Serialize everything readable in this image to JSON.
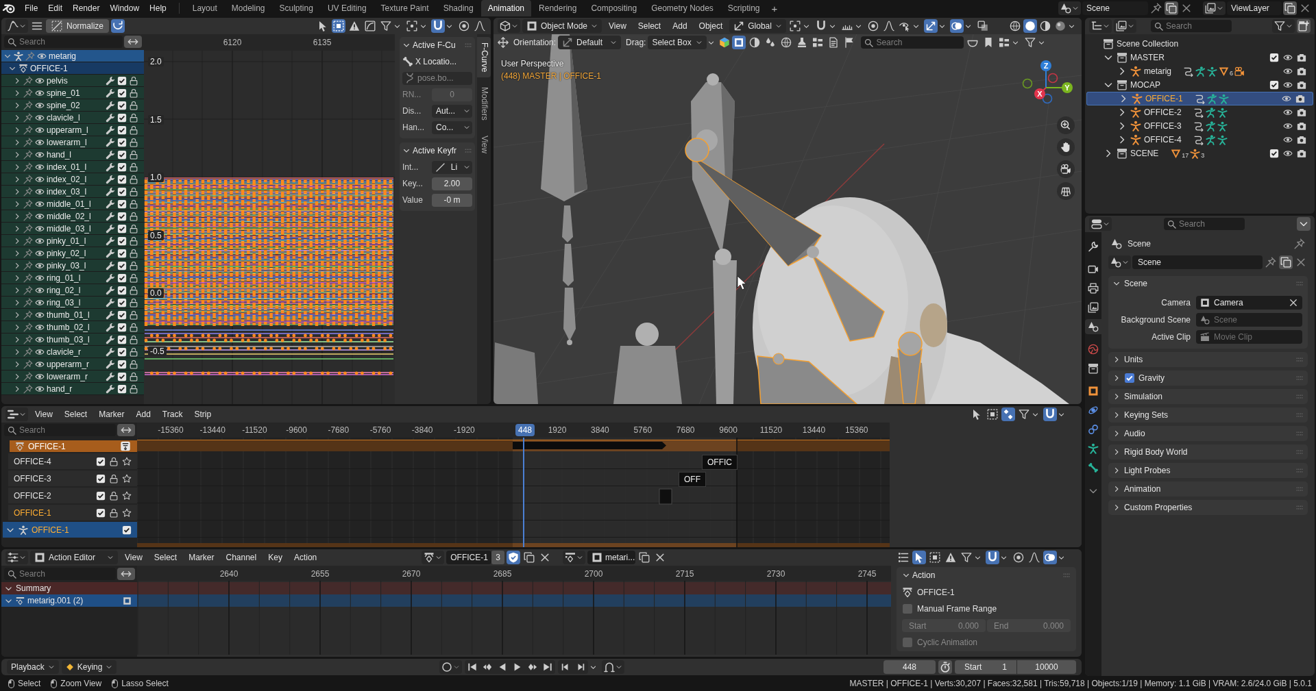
{
  "topbar": {
    "menus": [
      "File",
      "Edit",
      "Render",
      "Window",
      "Help"
    ],
    "workspaces": [
      {
        "label": "Layout",
        "selected": false
      },
      {
        "label": "Modeling",
        "selected": false
      },
      {
        "label": "Sculpting",
        "selected": false
      },
      {
        "label": "UV Editing",
        "selected": false
      },
      {
        "label": "Texture Paint",
        "selected": false
      },
      {
        "label": "Shading",
        "selected": false
      },
      {
        "label": "Animation",
        "selected": true
      },
      {
        "label": "Rendering",
        "selected": false
      },
      {
        "label": "Compositing",
        "selected": false
      },
      {
        "label": "Geometry Nodes",
        "selected": false
      },
      {
        "label": "Scripting",
        "selected": false
      }
    ],
    "add_workspace": "+",
    "scene": "Scene",
    "view_layer": "ViewLayer"
  },
  "graph_editor": {
    "normalize": "Normalize",
    "auto_normalize": true,
    "tools": [
      {
        "kind": "cursor",
        "on": false
      },
      {
        "kind": "box-select",
        "on": true
      },
      {
        "kind": "warning",
        "on": false
      },
      {
        "kind": "curve-box",
        "on": false
      },
      {
        "kind": "filter",
        "on": false
      },
      {
        "kind": "pivot",
        "on": false
      },
      {
        "kind": "magnet",
        "on": true
      },
      {
        "kind": "circle-dot",
        "on": false
      },
      {
        "kind": "falloff",
        "on": false
      }
    ],
    "search_placeholder": "Search",
    "channels": [
      {
        "name": "metarig",
        "kind": "object",
        "expanded": true,
        "children": [
          {
            "name": "OFFICE-1",
            "kind": "action",
            "expanded": true,
            "children": [
              {
                "name": "pelvis",
                "kind": "group",
                "expanded": false,
                "checked": true
              },
              {
                "name": "spine_01",
                "kind": "group",
                "expanded": false,
                "checked": true
              },
              {
                "name": "spine_02",
                "kind": "group",
                "expanded": false,
                "checked": true
              },
              {
                "name": "clavicle_l",
                "kind": "group",
                "expanded": false,
                "checked": true
              },
              {
                "name": "upperarm_l",
                "kind": "group",
                "expanded": false,
                "checked": true
              },
              {
                "name": "lowerarm_l",
                "kind": "group",
                "expanded": false,
                "checked": true
              },
              {
                "name": "hand_l",
                "kind": "group",
                "expanded": false,
                "checked": true
              },
              {
                "name": "index_01_l",
                "kind": "group",
                "expanded": false,
                "checked": true
              },
              {
                "name": "index_02_l",
                "kind": "group",
                "expanded": false,
                "checked": true
              },
              {
                "name": "index_03_l",
                "kind": "group",
                "expanded": false,
                "checked": true
              },
              {
                "name": "middle_01_l",
                "kind": "group",
                "expanded": false,
                "checked": true
              },
              {
                "name": "middle_02_l",
                "kind": "group",
                "expanded": false,
                "checked": true
              },
              {
                "name": "middle_03_l",
                "kind": "group",
                "expanded": false,
                "checked": true
              },
              {
                "name": "pinky_01_l",
                "kind": "group",
                "expanded": false,
                "checked": true
              },
              {
                "name": "pinky_02_l",
                "kind": "group",
                "expanded": false,
                "checked": true
              },
              {
                "name": "pinky_03_l",
                "kind": "group",
                "expanded": false,
                "checked": true
              },
              {
                "name": "ring_01_l",
                "kind": "group",
                "expanded": false,
                "checked": true
              },
              {
                "name": "ring_02_l",
                "kind": "group",
                "expanded": false,
                "checked": true
              },
              {
                "name": "ring_03_l",
                "kind": "group",
                "expanded": false,
                "checked": true
              },
              {
                "name": "thumb_01_l",
                "kind": "group",
                "expanded": false,
                "checked": true
              },
              {
                "name": "thumb_02_l",
                "kind": "group",
                "expanded": false,
                "checked": true
              },
              {
                "name": "thumb_03_l",
                "kind": "group",
                "expanded": false,
                "checked": true
              },
              {
                "name": "clavicle_r",
                "kind": "group",
                "expanded": false,
                "checked": true
              },
              {
                "name": "upperarm_r",
                "kind": "group",
                "expanded": false,
                "checked": true
              },
              {
                "name": "lowerarm_r",
                "kind": "group",
                "expanded": false,
                "checked": true
              },
              {
                "name": "hand_r",
                "kind": "group",
                "expanded": false,
                "checked": true
              }
            ]
          }
        ]
      }
    ],
    "ruler": [
      "6120",
      "6135"
    ],
    "y_ticks": [
      "2.0",
      "1.5",
      "1.0",
      "0.5",
      "0.0",
      "-0.5"
    ],
    "sidebar": {
      "fcurve_panel": {
        "title": "Active F-Cu",
        "expanded": true,
        "channel": "X Locatio...",
        "path": "pose.bo...",
        "rna_label": "RN...",
        "rna_index": "0",
        "display_label": "Dis...",
        "display": "Aut...",
        "handle_label": "Han...",
        "handle": "Co..."
      },
      "keyframe_panel": {
        "title": "Active Keyfr",
        "expanded": true,
        "interp_label": "Int...",
        "interp": "Li",
        "key_label": "Key...",
        "key": "2.00",
        "value_label": "Value",
        "value": "-0 m"
      }
    },
    "tabs": [
      {
        "label": "F-Curve",
        "selected": true
      },
      {
        "label": "Modifiers",
        "selected": false
      },
      {
        "label": "View",
        "selected": false
      }
    ]
  },
  "viewport": {
    "mode": "Object Mode",
    "menus": [
      "View",
      "Select",
      "Add",
      "Object"
    ],
    "transform": "Global",
    "tools": [
      {
        "kind": "pivot",
        "on": false
      },
      {
        "kind": "magnet",
        "on": false
      },
      {
        "kind": "ruler",
        "on": false
      },
      {
        "kind": "circle-dot",
        "on": false
      },
      {
        "kind": "falloff",
        "on": false
      },
      {
        "kind": "eye-cursor",
        "on": false
      },
      {
        "kind": "axis-arrows",
        "on": true
      },
      {
        "kind": "overlays",
        "on": true
      },
      {
        "kind": "xray",
        "on": false
      }
    ],
    "shading": [
      {
        "kind": "wire",
        "selected": false
      },
      {
        "kind": "solid",
        "selected": true
      },
      {
        "kind": "material",
        "selected": false
      },
      {
        "kind": "rendered",
        "selected": false
      }
    ],
    "orientation_label": "Orientation:",
    "orientation": "Default",
    "drag_label": "Drag:",
    "drag": "Select Box",
    "select_modes": [
      {
        "kind": "square",
        "on": true
      },
      {
        "kind": "material",
        "on": false
      },
      {
        "kind": "drops",
        "on": false
      },
      {
        "kind": "globe",
        "on": false
      },
      {
        "kind": "stamp",
        "on": false
      },
      {
        "kind": "layout",
        "on": false
      },
      {
        "kind": "document",
        "on": false
      },
      {
        "kind": "flag",
        "on": false
      }
    ],
    "search_placeholder": "Search",
    "view_name": "User Perspective",
    "info": "(448) MASTER | OFFICE-1",
    "gizmo": {
      "z": "Z",
      "y": "Y",
      "x": "X"
    }
  },
  "outliner": {
    "search_placeholder": "Search",
    "tree": [
      {
        "name": "Scene Collection",
        "kind": "scene-collection",
        "children": [
          {
            "name": "MASTER",
            "kind": "collection",
            "expanded": true,
            "checked": true,
            "children": [
              {
                "name": "metarig",
                "kind": "armature",
                "expanded": false,
                "selected": false,
                "extras": [
                  {
                    "kind": "pose"
                  },
                  {
                    "kind": "pose-figure"
                  },
                  {
                    "kind": "armature-data"
                  },
                  {
                    "kind": "mesh",
                    "count": "6"
                  },
                  {
                    "kind": "camera-object"
                  }
                ]
              }
            ]
          },
          {
            "name": "MOCAP",
            "kind": "collection",
            "expanded": true,
            "checked": true,
            "children": [
              {
                "name": "OFFICE-1",
                "kind": "armature",
                "expanded": false,
                "selected": true,
                "extras": [
                  {
                    "kind": "pose"
                  },
                  {
                    "kind": "pose-figure"
                  },
                  {
                    "kind": "armature-data"
                  }
                ]
              },
              {
                "name": "OFFICE-2",
                "kind": "armature",
                "expanded": false,
                "selected": false,
                "extras": [
                  {
                    "kind": "pose"
                  },
                  {
                    "kind": "pose-figure"
                  },
                  {
                    "kind": "armature-data"
                  }
                ]
              },
              {
                "name": "OFFICE-3",
                "kind": "armature",
                "expanded": false,
                "selected": false,
                "extras": [
                  {
                    "kind": "pose"
                  },
                  {
                    "kind": "pose-figure"
                  },
                  {
                    "kind": "armature-data"
                  }
                ]
              },
              {
                "name": "OFFICE-4",
                "kind": "armature",
                "expanded": false,
                "selected": false,
                "extras": [
                  {
                    "kind": "pose"
                  },
                  {
                    "kind": "pose-figure"
                  },
                  {
                    "kind": "armature-data"
                  }
                ]
              }
            ]
          },
          {
            "name": "SCENE",
            "kind": "collection",
            "expanded": false,
            "checked": true,
            "extras": [
              {
                "kind": "mesh",
                "count": "17"
              },
              {
                "kind": "armature-object",
                "count": "3"
              }
            ]
          }
        ]
      }
    ]
  },
  "properties": {
    "search_placeholder": "Search",
    "tabs": [
      {
        "kind": "tool",
        "selected": false
      },
      {
        "kind": "render",
        "selected": false
      },
      {
        "kind": "output",
        "selected": false
      },
      {
        "kind": "view-layer",
        "selected": false
      },
      {
        "kind": "scene",
        "selected": true
      },
      {
        "kind": "world",
        "selected": false
      },
      {
        "kind": "collection",
        "selected": false
      },
      {
        "kind": "object",
        "selected": false
      },
      {
        "kind": "physics",
        "selected": false
      },
      {
        "kind": "constraints",
        "selected": false
      },
      {
        "kind": "armature",
        "selected": false
      },
      {
        "kind": "bone",
        "selected": false
      }
    ],
    "context": "Scene",
    "datablock": "Scene",
    "panels": [
      {
        "title": "Scene",
        "expanded": true,
        "rows": [
          {
            "label": "Camera",
            "kind": "object",
            "value": "Camera"
          },
          {
            "label": "Background Scene",
            "kind": "scene",
            "placeholder": "Scene"
          },
          {
            "label": "Active Clip",
            "kind": "clip",
            "placeholder": "Movie Clip"
          }
        ]
      },
      {
        "title": "Units",
        "expanded": false
      },
      {
        "title": "Gravity",
        "expanded": false,
        "toggle": {
          "checked": true
        }
      },
      {
        "title": "Simulation",
        "expanded": false
      },
      {
        "title": "Keying Sets",
        "expanded": false
      },
      {
        "title": "Audio",
        "expanded": false
      },
      {
        "title": "Rigid Body World",
        "expanded": false
      },
      {
        "title": "Light Probes",
        "expanded": false
      },
      {
        "title": "Animation",
        "expanded": false
      },
      {
        "title": "Custom Properties",
        "expanded": false
      }
    ]
  },
  "nla": {
    "menus": [
      "View",
      "Select",
      "Marker",
      "Add",
      "Track",
      "Strip"
    ],
    "tools": [
      {
        "kind": "cursor",
        "on": false
      },
      {
        "kind": "box-select",
        "on": false
      },
      {
        "kind": "diamonds",
        "on": true
      },
      {
        "kind": "filter",
        "on": false
      },
      {
        "kind": "magnet",
        "on": true
      }
    ],
    "search_placeholder": "Search",
    "ruler": [
      "-15360",
      "-13440",
      "-11520",
      "-9600",
      "-7680",
      "-5760",
      "-3840",
      "-1920",
      "1920",
      "3840",
      "5760",
      "7680",
      "9600",
      "11520",
      "13440",
      "15360"
    ],
    "playhead": "448",
    "tracks": [
      {
        "name": "OFFICE-1",
        "kind": "action-line"
      },
      {
        "name": "OFFICE-4",
        "kind": "track",
        "checked": true,
        "active": false
      },
      {
        "name": "OFFICE-3",
        "kind": "track",
        "checked": true,
        "active": false
      },
      {
        "name": "OFFICE-2",
        "kind": "track",
        "checked": true,
        "active": false
      },
      {
        "name": "OFFICE-1",
        "kind": "track",
        "checked": true,
        "active": true
      },
      {
        "name": "OFFICE-1",
        "kind": "object",
        "checked": true,
        "expanded": true
      }
    ],
    "strips": [
      {
        "label": "OFFIC"
      },
      {
        "label": "OFF"
      }
    ]
  },
  "action_editor": {
    "mode": "Action Editor",
    "menus": [
      "View",
      "Select",
      "Marker",
      "Channel",
      "Key",
      "Action"
    ],
    "action": "OFFICE-1",
    "users": "3",
    "fake_user": true,
    "slot": "metari...",
    "tools": [
      {
        "kind": "channel-list",
        "on": false
      },
      {
        "kind": "cursor",
        "on": true
      },
      {
        "kind": "box-select",
        "on": false
      },
      {
        "kind": "warning",
        "on": false
      },
      {
        "kind": "filter",
        "on": false
      },
      {
        "kind": "magnet",
        "on": true
      },
      {
        "kind": "circle-dot",
        "on": false
      },
      {
        "kind": "falloff",
        "on": false
      },
      {
        "kind": "overlays",
        "on": true
      }
    ],
    "search_placeholder": "Search",
    "ruler": [
      "2640",
      "2655",
      "2670",
      "2685",
      "2700",
      "2715",
      "2730",
      "2745"
    ],
    "channels": [
      {
        "name": "Summary",
        "kind": "summary",
        "expanded": true
      },
      {
        "name": "metarig.001 (2)",
        "kind": "slot",
        "expanded": true
      }
    ],
    "sidebar": {
      "title": "Action",
      "expanded": true,
      "action": "OFFICE-1",
      "manual_range": {
        "label": "Manual Frame Range",
        "checked": false
      },
      "frame_range": {
        "disabled": true,
        "start_label": "Start",
        "start": "0.000",
        "end_label": "End",
        "end": "0.000"
      },
      "cyclic": {
        "label": "Cyclic Animation",
        "checked": false,
        "disabled": true
      }
    }
  },
  "playback_bar": {
    "playback": "Playback",
    "keying": "Keying",
    "current_frame": "448",
    "start_label": "Start",
    "start": "1",
    "end": "10000"
  },
  "status_bar": {
    "hints": [
      {
        "label": "Select"
      },
      {
        "label": "Zoom View"
      },
      {
        "label": "Lasso Select"
      }
    ],
    "stats": "MASTER | OFFICE-1 | Verts:30,207 | Faces:32,581 | Tris:59,718 | Objects:1/19 | Memory: 1.1 GiB | VRAM: 2.6/24.0 GiB | 5.0.1"
  }
}
